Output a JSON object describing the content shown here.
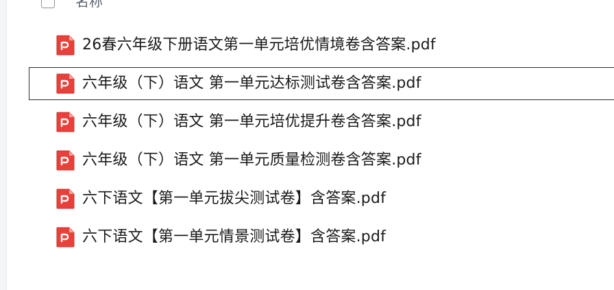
{
  "list_header": {
    "name_column": "名称"
  },
  "files": [
    {
      "name": "26春六年级下册语文第一单元培优情境卷含答案.pdf",
      "selected": false,
      "icon": "pdf-icon"
    },
    {
      "name": "六年级（下）语文 第一单元达标测试卷含答案.pdf",
      "selected": true,
      "icon": "pdf-icon"
    },
    {
      "name": "六年级（下）语文 第一单元培优提升卷含答案.pdf",
      "selected": false,
      "icon": "pdf-icon"
    },
    {
      "name": "六年级（下）语文 第一单元质量检测卷含答案.pdf",
      "selected": false,
      "icon": "pdf-icon"
    },
    {
      "name": "六下语文【第一单元拔尖测试卷】含答案.pdf",
      "selected": false,
      "icon": "pdf-icon"
    },
    {
      "name": "六下语文【第一单元情景测试卷】含答案.pdf",
      "selected": false,
      "icon": "pdf-icon"
    }
  ],
  "colors": {
    "pdf_red": "#e8413c",
    "selection_border": "#2b2b2b",
    "text": "#1a1a1a",
    "header_text": "#5b6472"
  }
}
